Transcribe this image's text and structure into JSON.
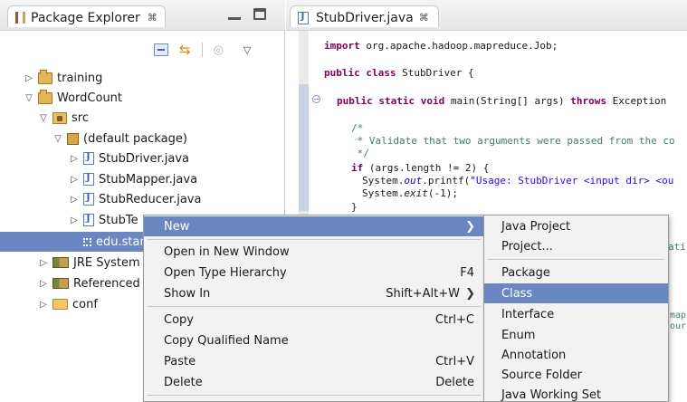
{
  "package_explorer": {
    "tab_title": "Package Explorer",
    "tab_close": "⌘",
    "toolbar_icons": [
      "collapse-all-icon",
      "link-with-editor-icon",
      "focus-icon",
      "view-menu-icon"
    ],
    "tree": [
      {
        "label": "training",
        "twisty": "▷",
        "icon": "project-icon"
      },
      {
        "label": "WordCount",
        "twisty": "▽",
        "icon": "project-icon"
      },
      {
        "label": "src",
        "twisty": "▽",
        "icon": "source-folder-icon"
      },
      {
        "label": "(default package)",
        "twisty": "▽",
        "icon": "package-icon"
      },
      {
        "label": "StubDriver.java",
        "twisty": "▷",
        "icon": "java-file-icon"
      },
      {
        "label": "StubMapper.java",
        "twisty": "▷",
        "icon": "java-file-icon"
      },
      {
        "label": "StubReducer.java",
        "twisty": "▷",
        "icon": "java-file-icon"
      },
      {
        "label": "StubTe",
        "twisty": "▷",
        "icon": "java-file-icon"
      },
      {
        "label": "edu.stanf",
        "twisty": "",
        "icon": "package-icon"
      },
      {
        "label": "JRE System L",
        "twisty": "▷",
        "icon": "library-icon"
      },
      {
        "label": "Referenced L",
        "twisty": "▷",
        "icon": "library-icon"
      },
      {
        "label": "conf",
        "twisty": "▷",
        "icon": "folder-icon"
      }
    ]
  },
  "editor": {
    "tab_title": "StubDriver.java",
    "tab_close": "⌘",
    "peek_right_1": "ati",
    "peek_right_2": "map",
    "peek_right_3": "our"
  },
  "context_menu": {
    "items": [
      {
        "label": "New",
        "accel": "",
        "submenu": true,
        "highlighted": true
      },
      {
        "label": "Open in New Window",
        "accel": ""
      },
      {
        "label": "Open Type Hierarchy",
        "accel": "F4"
      },
      {
        "label": "Show In",
        "accel": "Shift+Alt+W",
        "submenu": true
      },
      {
        "label": "Copy",
        "accel": "Ctrl+C"
      },
      {
        "label": "Copy Qualified Name",
        "accel": ""
      },
      {
        "label": "Paste",
        "accel": "Ctrl+V"
      },
      {
        "label": "Delete",
        "accel": "Delete"
      }
    ]
  },
  "new_submenu": {
    "items": [
      {
        "label": "Java Project"
      },
      {
        "label": "Project..."
      },
      {
        "label": "Package"
      },
      {
        "label": "Class",
        "highlighted": true
      },
      {
        "label": "Interface"
      },
      {
        "label": "Enum"
      },
      {
        "label": "Annotation"
      },
      {
        "label": "Source Folder"
      },
      {
        "label": "Java Working Set"
      }
    ]
  },
  "colors": {
    "selection": "#6b87c2",
    "keyword": "#7f0055",
    "comment": "#3f7f5f",
    "string": "#2a00ff"
  }
}
